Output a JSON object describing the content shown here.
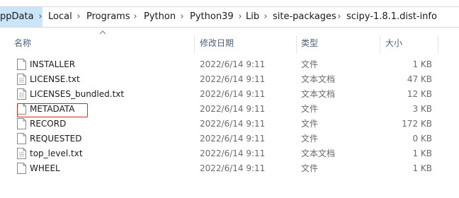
{
  "breadcrumb": [
    "ppData",
    "Local",
    "Programs",
    "Python",
    "Python39",
    "Lib",
    "site-packages",
    "scipy-1.8.1.dist-info"
  ],
  "columns": {
    "name": "名称",
    "date": "修改日期",
    "type": "类型",
    "size": "大小"
  },
  "files": [
    {
      "name": "INSTALLER",
      "date": "2022/6/14 9:11",
      "type": "文件",
      "size": "1 KB"
    },
    {
      "name": "LICENSE.txt",
      "date": "2022/6/14 9:11",
      "type": "文本文档",
      "size": "47 KB"
    },
    {
      "name": "LICENSES_bundled.txt",
      "date": "2022/6/14 9:11",
      "type": "文本文档",
      "size": "12 KB"
    },
    {
      "name": "METADATA",
      "date": "2022/6/14 9:11",
      "type": "文件",
      "size": "3 KB"
    },
    {
      "name": "RECORD",
      "date": "2022/6/14 9:11",
      "type": "文件",
      "size": "172 KB"
    },
    {
      "name": "REQUESTED",
      "date": "2022/6/14 9:11",
      "type": "文件",
      "size": "0 KB"
    },
    {
      "name": "top_level.txt",
      "date": "2022/6/14 9:11",
      "type": "文本文档",
      "size": "1 KB"
    },
    {
      "name": "WHEEL",
      "date": "2022/6/14 9:11",
      "type": "文件",
      "size": "1 KB"
    }
  ],
  "icons": {
    "sort": "sort-up-icon",
    "file": "file-icon",
    "separator": "chevron-right-icon"
  },
  "colors": {
    "selected_crumb": "#cce4f7",
    "highlight": "#e0261b",
    "header_text": "#4c607a"
  }
}
